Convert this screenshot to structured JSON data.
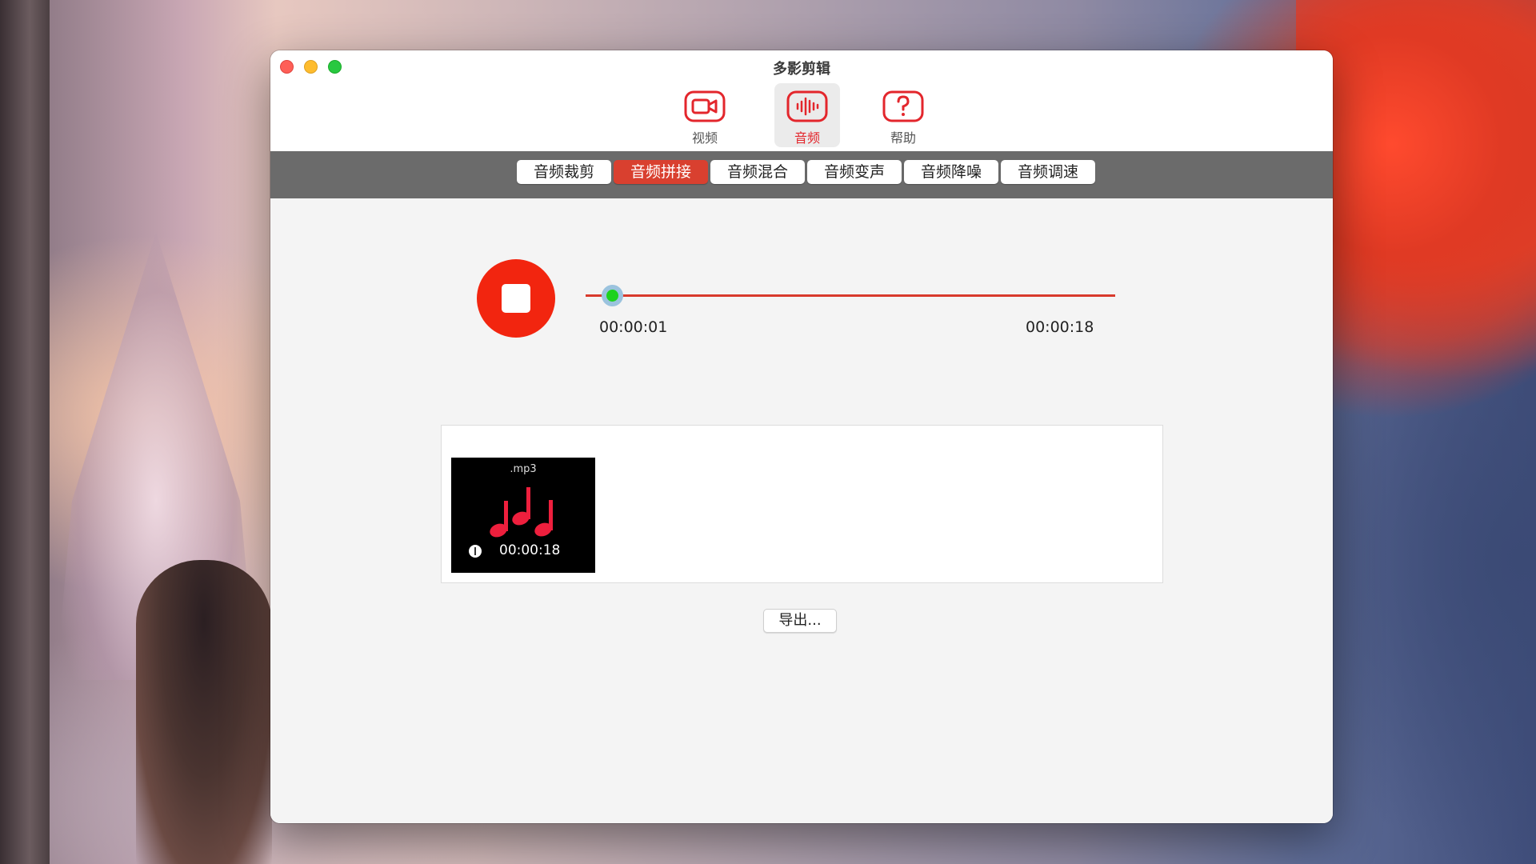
{
  "window": {
    "title": "多影剪辑"
  },
  "toolbar": {
    "items": [
      {
        "label": "视频",
        "icon": "video-camera-icon"
      },
      {
        "label": "音频",
        "icon": "audio-waveform-icon",
        "active": true
      },
      {
        "label": "帮助",
        "icon": "help-question-icon"
      }
    ]
  },
  "tabs": [
    {
      "label": "音频裁剪"
    },
    {
      "label": "音频拼接",
      "active": true
    },
    {
      "label": "音频混合"
    },
    {
      "label": "音频变声"
    },
    {
      "label": "音频降噪"
    },
    {
      "label": "音频调速"
    }
  ],
  "player": {
    "current_time": "00:00:01",
    "total_time": "00:00:18",
    "progress": 0.05,
    "button_icon": "stop-icon"
  },
  "files": [
    {
      "extension": ".mp3",
      "duration": "00:00:18",
      "thumbnail_icon": "music-notes-icon"
    }
  ],
  "export": {
    "label": "导出..."
  },
  "colors": {
    "accent": "#e3262c",
    "tab_active": "#d9402f",
    "stop_button": "#f2250f",
    "progress_line": "#d83a2c",
    "knob": "#1ed21e",
    "tab_bar": "#6b6b6b"
  }
}
